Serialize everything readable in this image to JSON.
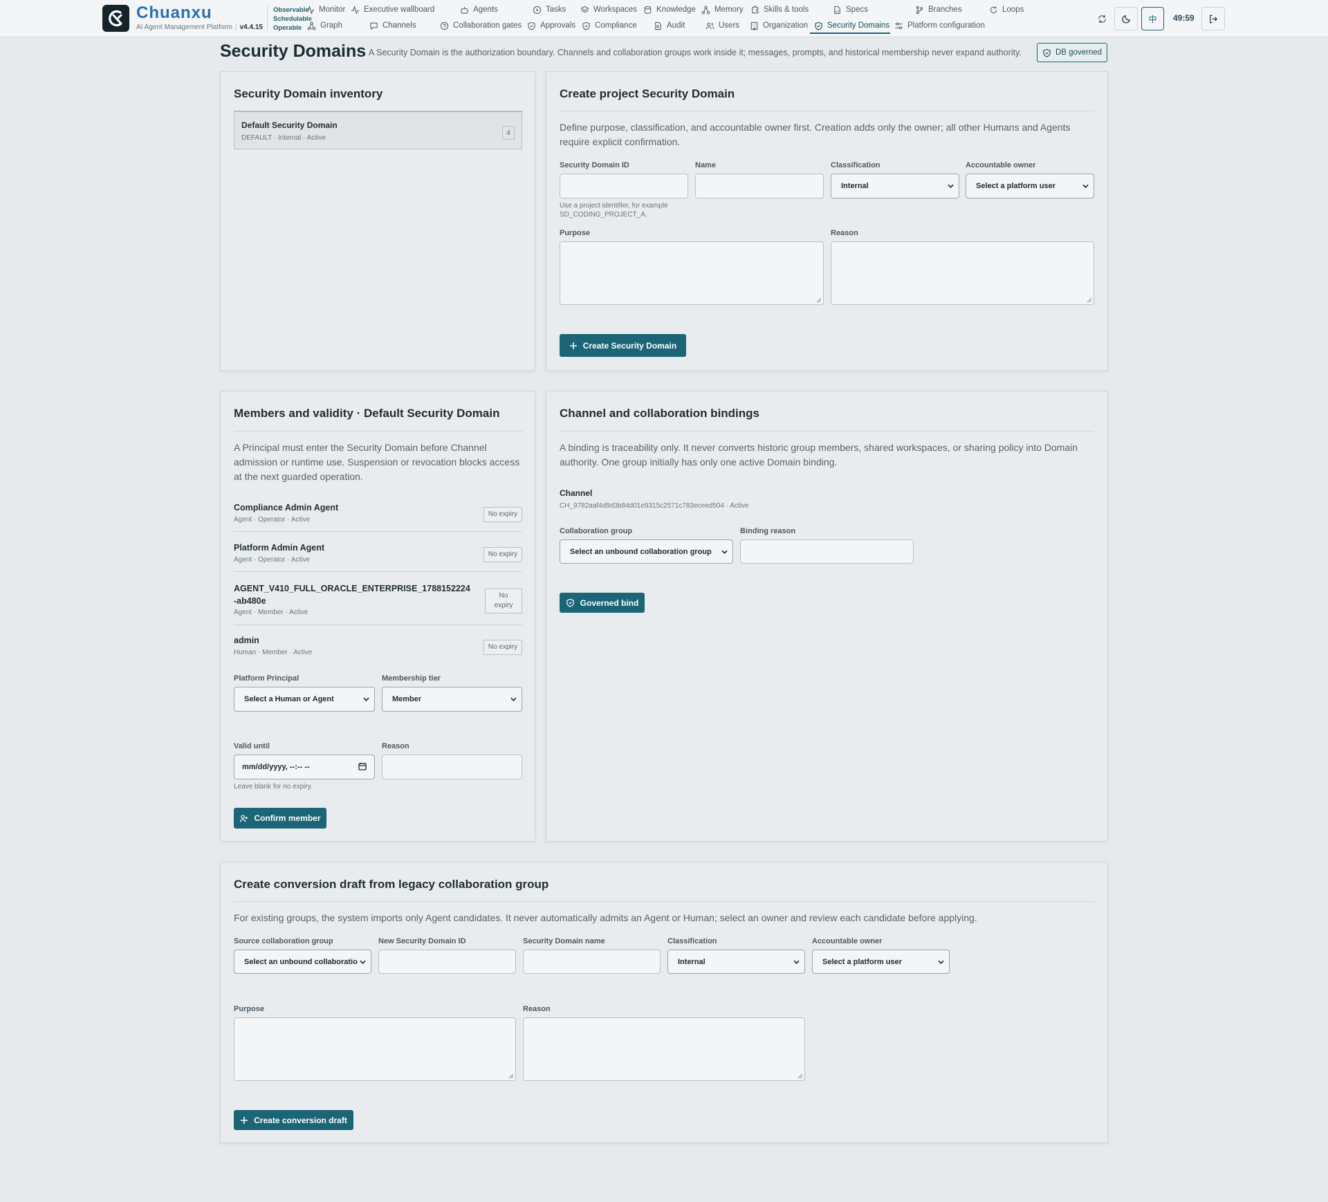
{
  "app": {
    "brand": "Chuanxu",
    "subtitle": "AI Agent Management Platform",
    "version": "v4.4.15",
    "tagline": [
      "Observable",
      "Schedulable",
      "Operable"
    ]
  },
  "nav": {
    "row1": [
      "Monitor",
      "Executive wallboard",
      "Agents",
      "Tasks",
      "Workspaces",
      "Knowledge",
      "Memory",
      "Skills & tools",
      "Specs",
      "Branches",
      "Loops"
    ],
    "row2": [
      "Graph",
      "Channels",
      "Collaboration gates",
      "Approvals",
      "Compliance",
      "Audit",
      "Users",
      "Organization",
      "Security Domains",
      "Platform configuration"
    ],
    "active": "Security Domains"
  },
  "toolbar": {
    "lang": "中",
    "timer": "49:59"
  },
  "page": {
    "title": "Security Domains",
    "description": "A Security Domain is the authorization boundary. Channels and collaboration groups work inside it; messages, prompts, and historical membership never expand authority.",
    "badge": "DB governed"
  },
  "inventory": {
    "title": "Security Domain inventory",
    "items": [
      {
        "name": "Default Security Domain",
        "meta": "DEFAULT · Internal · Active",
        "count": "4"
      }
    ]
  },
  "create_domain": {
    "title": "Create project Security Domain",
    "description": "Define purpose, classification, and accountable owner first. Creation adds only the owner; all other Humans and Agents require explicit confirmation.",
    "id_label": "Security Domain ID",
    "id_hint": "Use a project identifier, for example SD_CODING_PROJECT_A.",
    "name_label": "Name",
    "classification_label": "Classification",
    "classification_value": "Internal",
    "owner_label": "Accountable owner",
    "owner_value": "Select a platform user",
    "purpose_label": "Purpose",
    "reason_label": "Reason",
    "button": "Create Security Domain"
  },
  "members": {
    "title": "Members and validity · Default Security Domain",
    "description": "A Principal must enter the Security Domain before Channel admission or runtime use. Suspension or revocation blocks access at the next guarded operation.",
    "list": [
      {
        "name": "Compliance Admin Agent",
        "meta": "Agent · Operator · Active",
        "expiry": "No expiry"
      },
      {
        "name": "Platform Admin Agent",
        "meta": "Agent · Operator · Active",
        "expiry": "No expiry"
      },
      {
        "name": "AGENT_V410_FULL_ORACLE_ENTERPRISE_1788152224-ab480e",
        "meta": "Agent · Member · Active",
        "expiry": "No expiry"
      },
      {
        "name": "admin",
        "meta": "Human · Member · Active",
        "expiry": "No expiry"
      }
    ],
    "principal_label": "Platform Principal",
    "principal_value": "Select a Human or Agent",
    "tier_label": "Membership tier",
    "tier_value": "Member",
    "valid_label": "Valid until",
    "valid_value": "mm/dd/yyyy, --:-- --",
    "valid_hint": "Leave blank for no expiry.",
    "reason_label": "Reason",
    "button": "Confirm member"
  },
  "bindings": {
    "title": "Channel and collaboration bindings",
    "description": "A binding is traceability only. It never converts historic group members, shared workspaces, or sharing policy into Domain authority. One group initially has only one active Domain binding.",
    "channel_label": "Channel",
    "channel_meta": "CH_9782aaf4d9d3b84d01e9315c2571c783eceed504 · Active",
    "group_label": "Collaboration group",
    "group_value": "Select an unbound collaboration group",
    "reason_label": "Binding reason",
    "button": "Governed bind"
  },
  "conversion": {
    "title": "Create conversion draft from legacy collaboration group",
    "description": "For existing groups, the system imports only Agent candidates. It never automatically admits an Agent or Human; select an owner and review each candidate before applying.",
    "source_label": "Source collaboration group",
    "source_value": "Select an unbound collaboration group",
    "new_id_label": "New Security Domain ID",
    "name_label": "Security Domain name",
    "classification_label": "Classification",
    "classification_value": "Internal",
    "owner_label": "Accountable owner",
    "owner_value": "Select a platform user",
    "purpose_label": "Purpose",
    "reason_label": "Reason",
    "button": "Create conversion draft"
  },
  "colors": {
    "accent": "#1c6577",
    "brand": "#2a6fb3",
    "background": "#e6eaed",
    "panel": "#e9ecee"
  },
  "icons": [
    "logo-icon",
    "refresh-icon",
    "moon-icon",
    "logout-icon",
    "shield-icon",
    "plus-icon",
    "user-plus-icon",
    "calendar-icon",
    "chevron-down-icon"
  ]
}
